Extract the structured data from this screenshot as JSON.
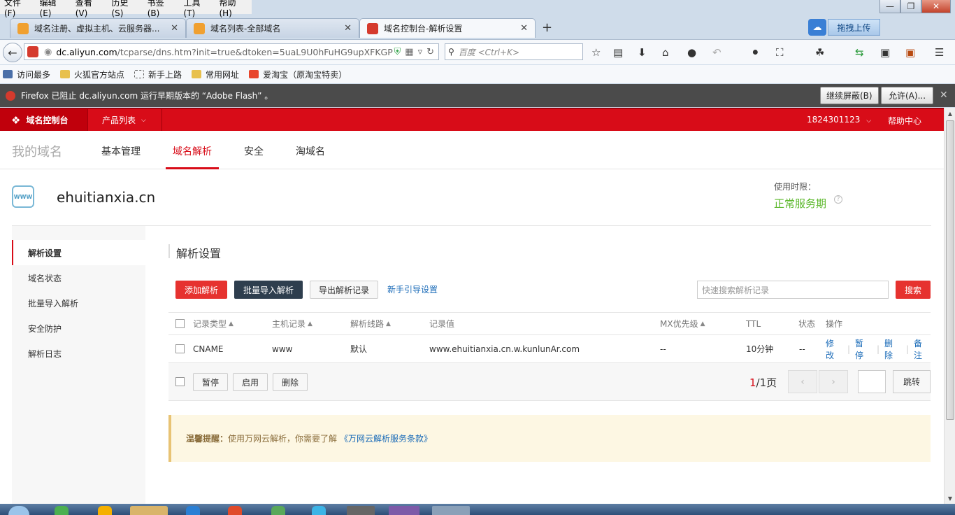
{
  "browser": {
    "menu": [
      "文件(F)",
      "编辑(E)",
      "查看(V)",
      "历史(S)",
      "书签(B)",
      "工具(T)",
      "帮助(H)"
    ],
    "tabs": [
      {
        "title": "域名注册、虚拟主机、云服务器...",
        "icon_color": "#f0a030"
      },
      {
        "title": "域名列表-全部域名",
        "icon_color": "#f0a030"
      },
      {
        "title": "域名控制台-解析设置",
        "icon_color": "#d53a2d"
      }
    ],
    "upload_label": "拖拽上传",
    "url_prefix": "dc.aliyun.com",
    "url_rest": "/tcparse/dns.htm?init=true&dtoken=5uaL9U0hFuHG9upXFKGP",
    "search_placeholder": "百度 <Ctrl+K>",
    "bookmarks": [
      "访问最多",
      "火狐官方站点",
      "新手上路",
      "常用网址",
      "爱淘宝（原淘宝特卖）"
    ],
    "flash_notice": "Firefox 已阻止 dc.aliyun.com 运行早期版本的 “Adobe Flash” 。",
    "flash_continue": "继续屏蔽(B)",
    "flash_allow": "允许(A)..."
  },
  "console": {
    "name": "域名控制台",
    "product_menu": "产品列表",
    "account": "1824301123",
    "help": "帮助中心"
  },
  "subnav": {
    "title": "我的域名",
    "tabs": [
      "基本管理",
      "域名解析",
      "安全",
      "淘域名"
    ]
  },
  "domain": {
    "name": "ehuitianxia.cn",
    "icon_text": "WWW",
    "expiry_label": "使用时限：",
    "expiry_status": "正常服务期"
  },
  "sidebar": {
    "items": [
      "解析设置",
      "域名状态",
      "批量导入解析",
      "安全防护",
      "解析日志"
    ]
  },
  "main": {
    "title": "解析设置",
    "buttons": {
      "add": "添加解析",
      "import": "批量导入解析",
      "export": "导出解析记录",
      "guide": "新手引导设置",
      "search": "搜索"
    },
    "search_placeholder": "快速搜索解析记录",
    "columns": [
      "记录类型",
      "主机记录",
      "解析线路",
      "记录值",
      "MX优先级",
      "TTL",
      "状态",
      "操作"
    ],
    "rows": [
      {
        "type": "CNAME",
        "host": "www",
        "line": "默认",
        "value": "www.ehuitianxia.cn.w.kunlunAr.com",
        "mx": "--",
        "ttl": "10分钟",
        "status": "--",
        "ops": [
          "修改",
          "暂停",
          "删除",
          "备注"
        ]
      }
    ],
    "footer_buttons": [
      "暂停",
      "启用",
      "删除"
    ],
    "pager": {
      "current": "1",
      "total": "/1页",
      "goto": "跳转"
    },
    "notice": {
      "label": "温馨提醒：",
      "text": "使用万网云解析，你需要了解",
      "link": "《万网云解析服务条款》"
    }
  },
  "colors": {
    "brand_red": "#d80c18",
    "link_blue": "#1a6bb8",
    "ok_green": "#5cb82c"
  }
}
